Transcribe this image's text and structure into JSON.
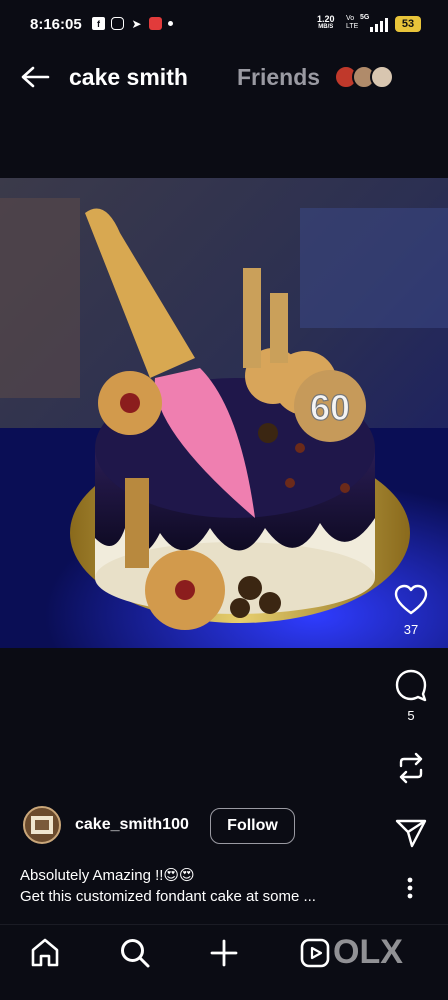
{
  "status_bar": {
    "time": "8:16:05",
    "speed_value": "1.20",
    "speed_unit": "MB/S",
    "volte": "Vo LTE",
    "network": "5G",
    "battery": "53"
  },
  "header": {
    "title": "cake smith",
    "friends_label": "Friends"
  },
  "post": {
    "likes": "37",
    "comments": "5",
    "author": "cake_smith100",
    "follow_label": "Follow",
    "caption_line1": "Absolutely Amazing !!😍😍",
    "caption_line2": "Get this customized fondant cake at some ...",
    "cake_topper_text": "60"
  },
  "watermark": "OLX",
  "icons": {
    "back": "arrow-left-icon",
    "like": "heart-icon",
    "comment": "comment-icon",
    "repost": "repost-icon",
    "share": "send-icon",
    "more": "more-vertical-icon",
    "home": "home-icon",
    "search": "search-icon",
    "create": "plus-icon",
    "reels": "reels-icon"
  },
  "colors": {
    "background": "#0b0c14",
    "text": "#ffffff",
    "muted": "#9a9aa2",
    "battery": "#e8c43a"
  }
}
